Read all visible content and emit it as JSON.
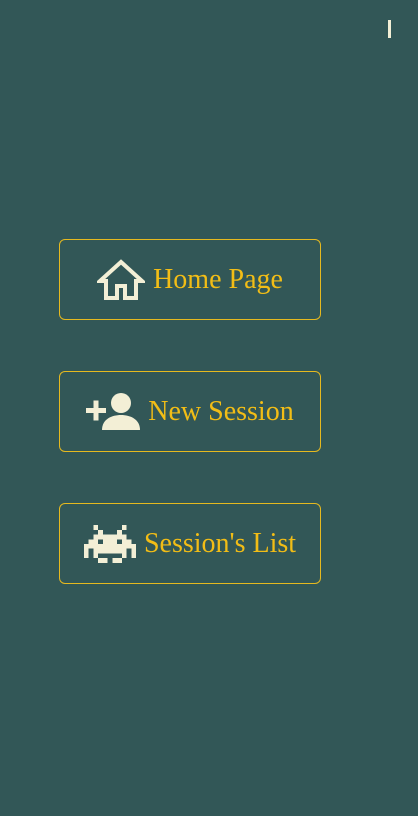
{
  "colors": {
    "background": "#325757",
    "accent": "#f2bd16",
    "border": "#e6b91f",
    "icon": "#f3efd6"
  },
  "menu": {
    "home": {
      "label": "Home Page",
      "icon": "home-icon"
    },
    "new_session": {
      "label": "New Session",
      "icon": "person-add-icon"
    },
    "sessions_list": {
      "label": "Session's List",
      "icon": "space-invader-icon"
    }
  }
}
